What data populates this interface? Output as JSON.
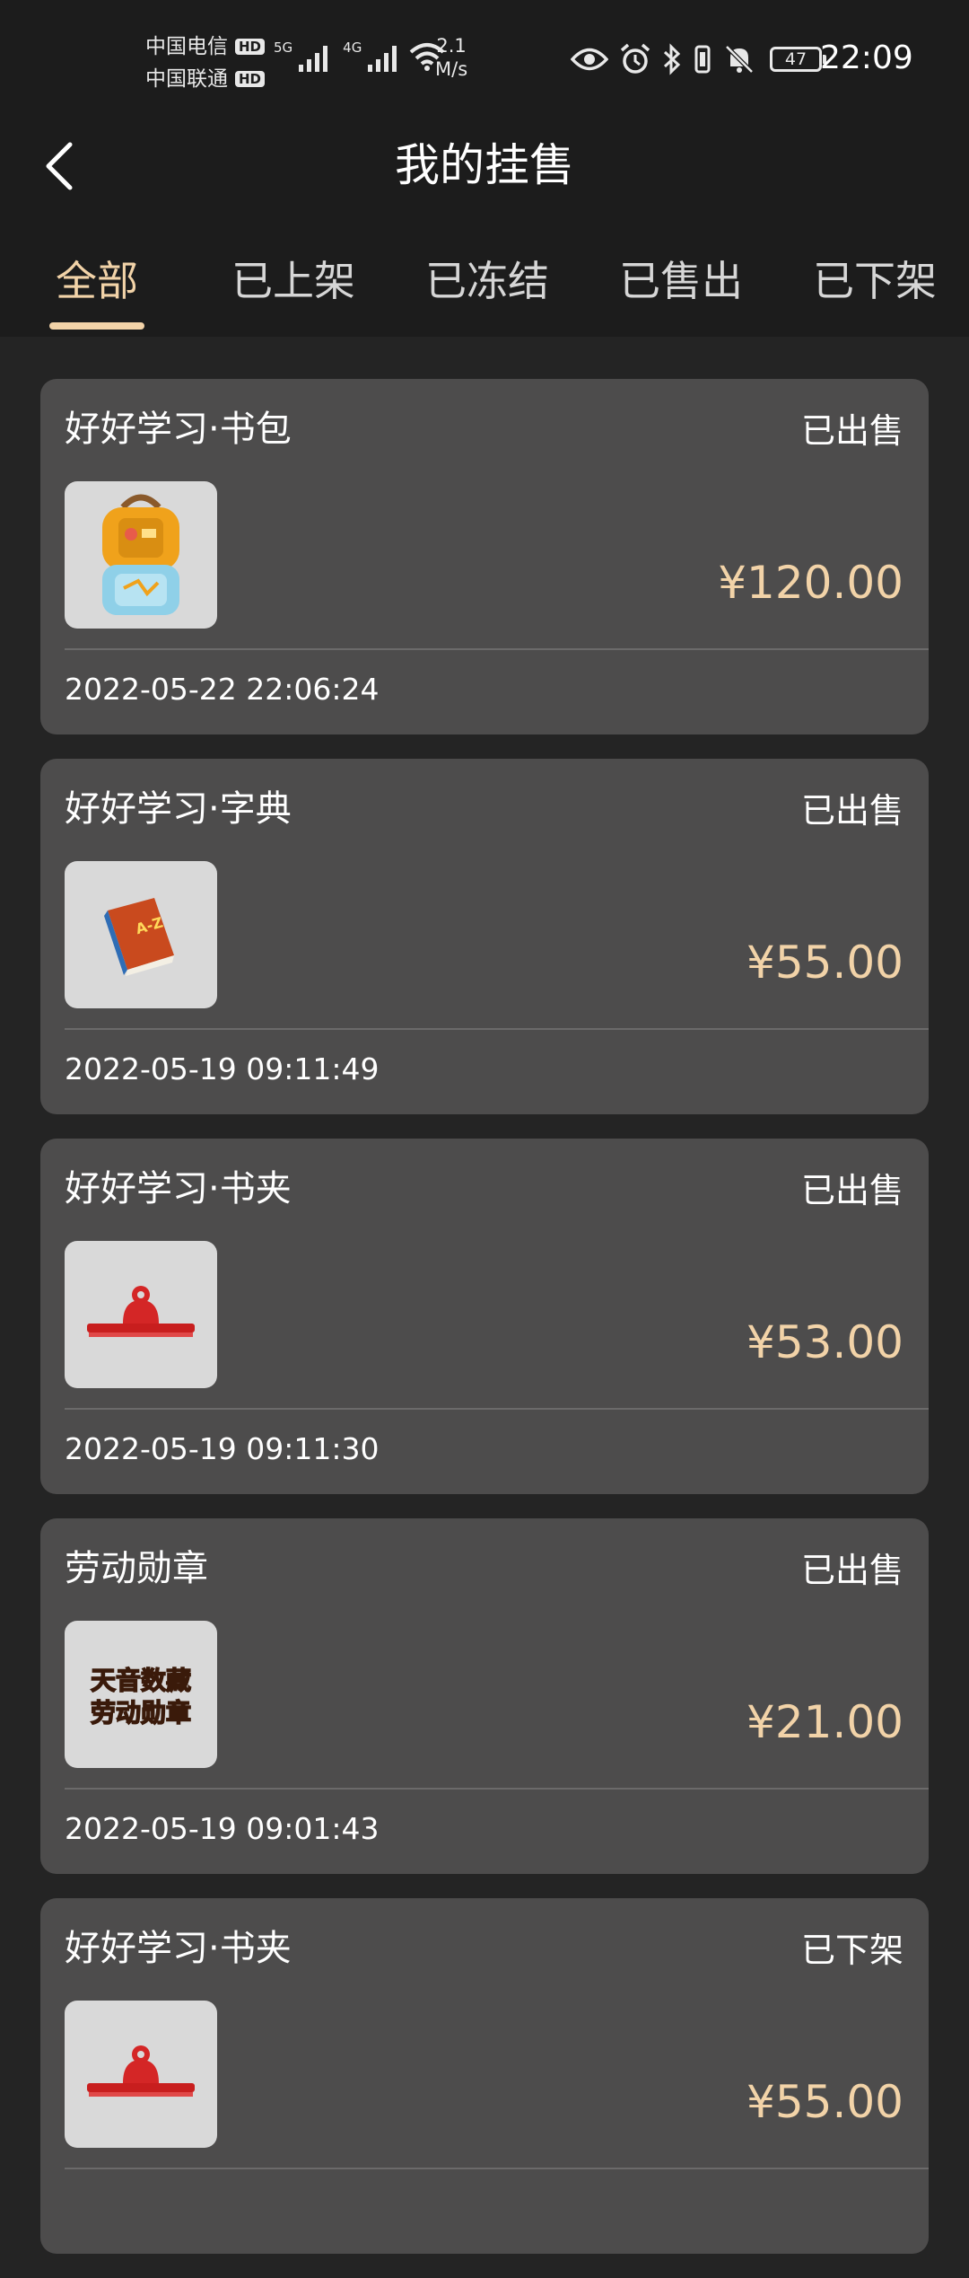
{
  "status_bar": {
    "carrier1": "中国电信",
    "carrier2": "中国联通",
    "hd_label": "HD",
    "net1": "5G",
    "net2": "4G",
    "speed_value": "2.1",
    "speed_unit": "M/s",
    "battery": "47",
    "time": "22:09",
    "icons": [
      "signal-icon",
      "wifi-icon",
      "eye-icon",
      "alarm-icon",
      "bluetooth-icon",
      "vibrate-icon",
      "mute-icon",
      "battery-icon"
    ]
  },
  "header": {
    "title": "我的挂售",
    "back_icon": "chevron-left-icon"
  },
  "tabs": [
    {
      "label": "全部",
      "active": true
    },
    {
      "label": "已上架",
      "active": false
    },
    {
      "label": "已冻结",
      "active": false
    },
    {
      "label": "已售出",
      "active": false
    },
    {
      "label": "已下架",
      "active": false
    }
  ],
  "colors": {
    "accent": "#f2d3a8",
    "background": "#242424",
    "card": "#4d4c4c",
    "header": "#1c1c1c"
  },
  "listings": [
    {
      "title": "好好学习·书包",
      "status": "已出售",
      "price": "¥120.00",
      "time": "2022-05-22 22:06:24",
      "image": "backpack-image"
    },
    {
      "title": "好好学习·字典",
      "status": "已出售",
      "price": "¥55.00",
      "time": "2022-05-19 09:11:49",
      "image": "dictionary-image",
      "image_text": "A-Z"
    },
    {
      "title": "好好学习·书夹",
      "status": "已出售",
      "price": "¥53.00",
      "time": "2022-05-19 09:11:30",
      "image": "binder-clip-image"
    },
    {
      "title": "劳动勋章",
      "status": "已出售",
      "price": "¥21.00",
      "time": "2022-05-19 09:01:43",
      "image": "labor-medal-image",
      "image_text": [
        "天音数藏",
        "劳动勋章"
      ]
    },
    {
      "title": "好好学习·书夹",
      "status": "已下架",
      "price": "¥55.00",
      "time": "",
      "image": "binder-clip-image"
    }
  ]
}
